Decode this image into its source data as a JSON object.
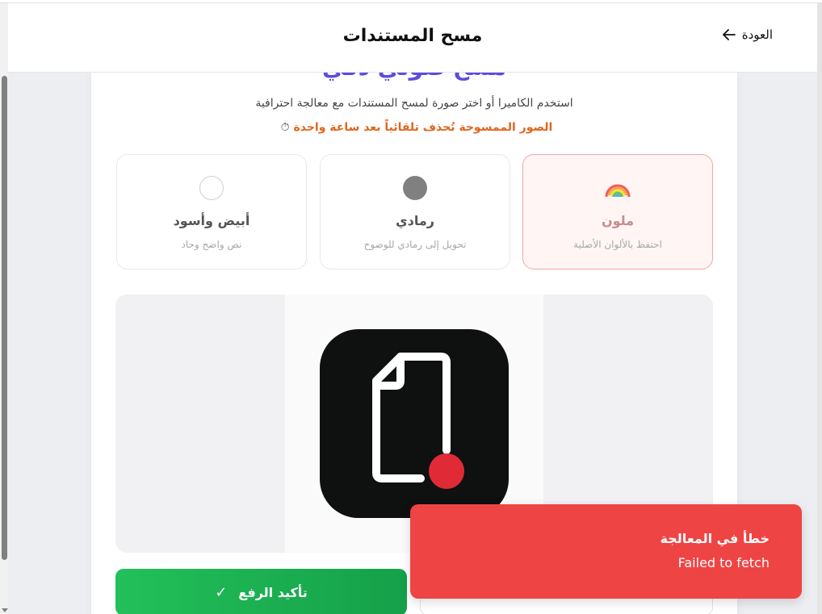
{
  "header": {
    "title": "مسح المستندات",
    "back_label": "العودة",
    "back_icon": "arrow-left-icon"
  },
  "card": {
    "hero_title": "مسح ضوئي ذكي",
    "subtitle": "استخدم الكاميرا أو اختر صورة لمسح المستندات مع معالجة احترافية",
    "warning": "الصور الممسوحة تُحذف تلقائياً بعد ساعة واحدة",
    "warning_icon": "⏱"
  },
  "modes": [
    {
      "label": "ملون",
      "description": "احتفظ بالألوان الأصلية",
      "icon": "rainbow-icon",
      "selected": true
    },
    {
      "label": "رمادي",
      "description": "تحويل إلى رمادي للوضوح",
      "icon": "gray-circle-icon",
      "selected": false
    },
    {
      "label": "أبيض وأسود",
      "description": "نص واضح وحاد",
      "icon": "white-circle-icon",
      "selected": false
    }
  ],
  "actions": {
    "confirm_label": "تأكيد الرفع",
    "confirm_icon": "✓"
  },
  "toast": {
    "title": "خطأ في المعالجة",
    "message": "Failed to fetch"
  },
  "colors": {
    "accent": "#5b4dde",
    "warning": "#e0661f",
    "success": "#1fb352",
    "error": "#ef4444",
    "selected_border": "#f0a7a7"
  }
}
